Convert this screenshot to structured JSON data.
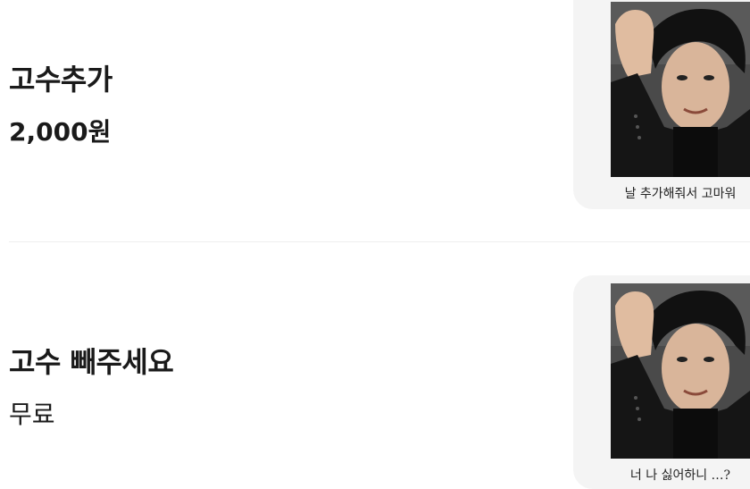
{
  "menu": {
    "items": [
      {
        "title": "고수추가",
        "price": "2,000원",
        "caption": "날 추가해줘서 고마워"
      },
      {
        "title": "고수 빼주세요",
        "price": "무료",
        "caption": "너 나 싫어하니 …?"
      }
    ]
  }
}
